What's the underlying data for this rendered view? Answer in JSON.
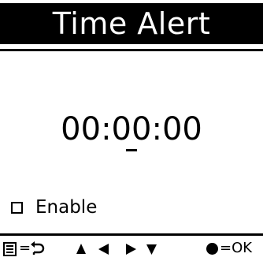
{
  "header": {
    "title": "Time Alert"
  },
  "time": {
    "hours": "00",
    "sep1": ":",
    "minutes": "00",
    "sep2": ":",
    "seconds": "00",
    "cursor_field": "minutes"
  },
  "enable": {
    "label": "Enable",
    "checked": false
  },
  "help_bar": {
    "menu_equals": "=",
    "ok_label": "=OK",
    "icons": [
      "menu-icon",
      "back-icon",
      "up-arrow-icon",
      "left-arrow-icon",
      "right-arrow-icon",
      "down-arrow-icon",
      "ok-button-icon"
    ]
  },
  "colors": {
    "foreground": "#000000",
    "background": "#ffffff",
    "title_text": "#ffffff"
  }
}
